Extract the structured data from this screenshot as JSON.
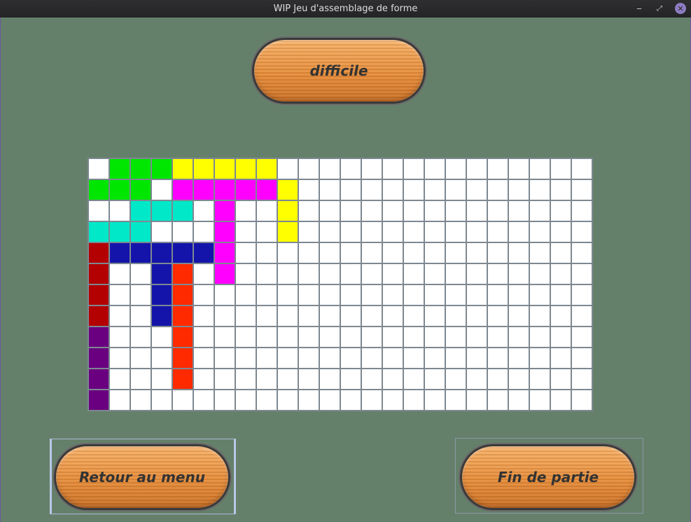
{
  "window": {
    "title": "WIP Jeu d'assemblage de forme",
    "controls": {
      "minimize": "‒",
      "maximize": "⤢",
      "close": "✕"
    }
  },
  "buttons": {
    "difficulty": "difficile",
    "menu": "Retour au menu",
    "end": "Fin de partie"
  },
  "colors": {
    "background": "#65806a",
    "empty": "#ffffff",
    "G": "#00e600",
    "Y": "#ffff00",
    "M": "#ff00ff",
    "C": "#00e8c8",
    "R": "#b30000",
    "B": "#1414aa",
    "O": "#ff2a00",
    "P": "#6a0080"
  },
  "board": {
    "columns": 24,
    "rows": [
      ".GGGYYYYY...............",
      "GGG.MMMMMY..............",
      "..CCC.M..Y..............",
      "CCC...M..Y..............",
      "RBBBBBM.................",
      "R..BO.M.................",
      "R..BO...................",
      "R..BO...................",
      "P...O...................",
      "P...O...................",
      "P...O...................",
      "P......................."
    ]
  }
}
